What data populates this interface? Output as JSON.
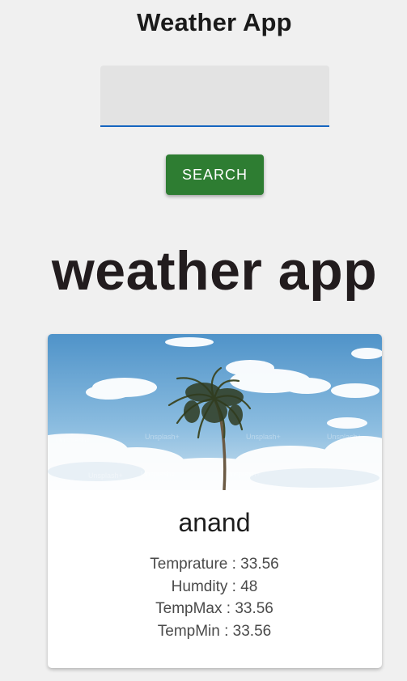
{
  "app": {
    "title": "Weather App"
  },
  "search": {
    "value": "",
    "placeholder": "",
    "button_label": "SEARCH"
  },
  "hero": {
    "heading": "weather app"
  },
  "card": {
    "image": {
      "icon": "palm-tree-sky-photo",
      "watermark": "Unsplash+"
    },
    "city": "anand",
    "stats": {
      "temperature": "Temprature : 33.56",
      "humidity": "Humdity : 48",
      "temp_max": "TempMax : 33.56",
      "temp_min": "TempMin : 33.56"
    }
  },
  "colors": {
    "background": "#f0f0f0",
    "button": "#2e7d32",
    "input_underline": "#1565c0",
    "card": "#ffffff"
  }
}
